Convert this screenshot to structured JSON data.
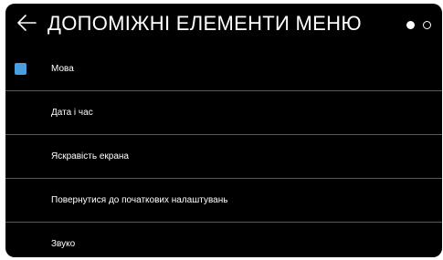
{
  "header": {
    "title": "ДОПОМІЖНІ ЕЛЕМЕНТИ МЕНЮ",
    "back_icon": "arrow-left-icon",
    "pager": {
      "pages": 2,
      "current": 1
    }
  },
  "menu": {
    "items": [
      {
        "label": "Мова",
        "selected": true
      },
      {
        "label": "Дата і час",
        "selected": false
      },
      {
        "label": "Яскравість екрана",
        "selected": false
      },
      {
        "label": "Повернутися до початкових налаштувань",
        "selected": false
      },
      {
        "label": "Звуко",
        "selected": false
      }
    ]
  },
  "colors": {
    "background": "#000000",
    "text": "#ffffff",
    "accent": "#4a9fe0",
    "divider": "#5a5a5a"
  }
}
